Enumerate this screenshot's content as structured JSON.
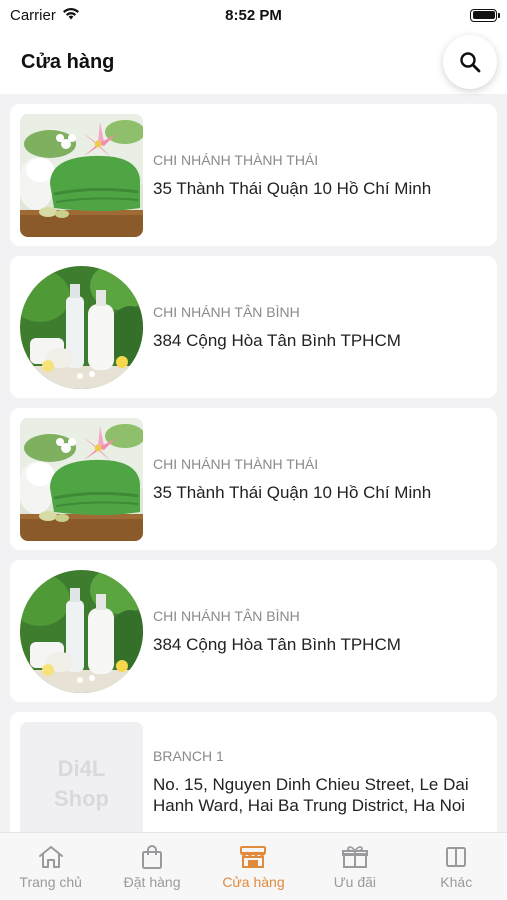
{
  "status_bar": {
    "carrier": "Carrier",
    "time": "8:52 PM"
  },
  "header": {
    "title": "Cửa hàng"
  },
  "stores": [
    {
      "branch": "CHI NHÁNH THÀNH THÁI",
      "address": "35 Thành Thái Quận 10 Hồ Chí Minh",
      "image": "spa-towel-orchid"
    },
    {
      "branch": "CHI NHÁNH TÂN BÌNH",
      "address": "384 Cộng Hòa Tân Bình TPHCM",
      "image": "cosmetic-bottles"
    },
    {
      "branch": "CHI NHÁNH THÀNH THÁI",
      "address": "35 Thành Thái Quận 10 Hồ Chí Minh",
      "image": "spa-towel-orchid"
    },
    {
      "branch": "CHI NHÁNH TÂN BÌNH",
      "address": "384 Cộng Hòa Tân Bình TPHCM",
      "image": "cosmetic-bottles"
    },
    {
      "branch": "BRANCH 1",
      "address": "No. 15, Nguyen Dinh Chieu Street, Le Dai Hanh Ward, Hai Ba Trung District, Ha Noi",
      "image": "placeholder",
      "placeholder_line1": "Di4L",
      "placeholder_line2": "Shop"
    }
  ],
  "tabbar": {
    "items": [
      {
        "label": "Trang chủ",
        "icon": "home-icon"
      },
      {
        "label": "Đặt hàng",
        "icon": "shopping-bag-icon"
      },
      {
        "label": "Cửa hàng",
        "icon": "store-icon",
        "active": true
      },
      {
        "label": "Ưu đãi",
        "icon": "gift-icon"
      },
      {
        "label": "Khác",
        "icon": "more-panel-icon"
      }
    ]
  },
  "colors": {
    "accent": "#e08a3c",
    "inactive": "#9a9a9e",
    "background": "#f2f2f4"
  }
}
